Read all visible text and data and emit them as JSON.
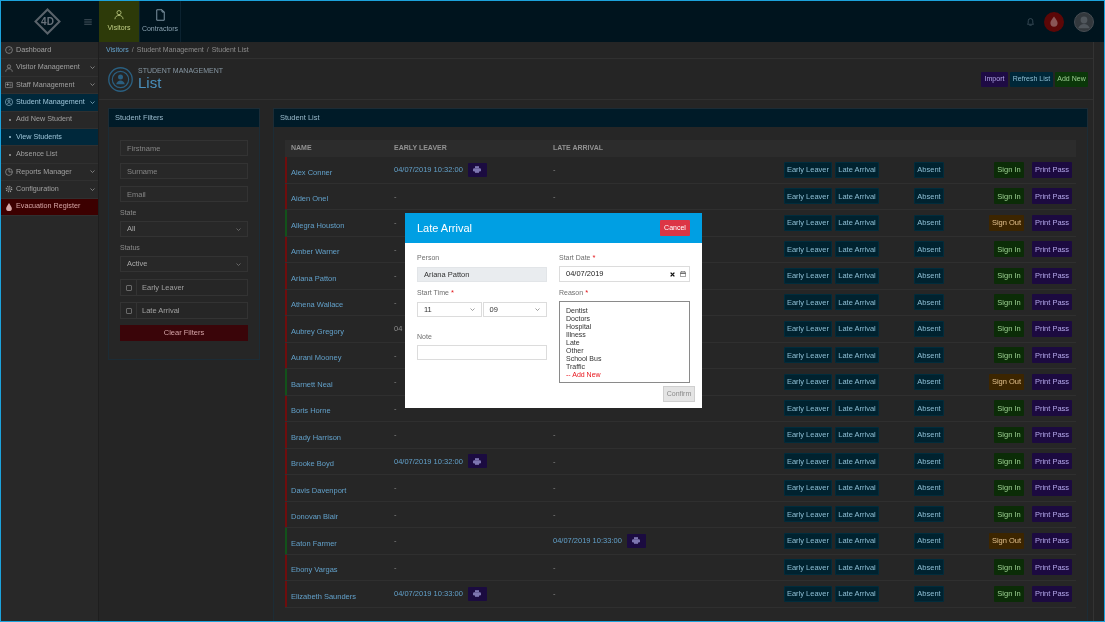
{
  "header": {
    "logo": "4D",
    "tabs": [
      {
        "label": "Visitors",
        "selected": true
      },
      {
        "label": "Contractors",
        "selected": false
      }
    ]
  },
  "sidebar": {
    "items": [
      {
        "label": "Dashboard",
        "kind": "link",
        "selected": false
      },
      {
        "label": "Visitor Management",
        "kind": "group",
        "selected": false
      },
      {
        "label": "Staff Management",
        "kind": "group",
        "selected": false
      },
      {
        "label": "Student Management",
        "kind": "group",
        "selected": true,
        "children": [
          {
            "label": "Add New Student",
            "selected": false
          },
          {
            "label": "View Students",
            "selected": true
          },
          {
            "label": "Absence List",
            "selected": false
          }
        ]
      },
      {
        "label": "Reports Manager",
        "kind": "group",
        "selected": false
      },
      {
        "label": "Configuration",
        "kind": "group",
        "selected": false
      },
      {
        "label": "Evacuation Register",
        "kind": "alert",
        "selected": false
      }
    ]
  },
  "breadcrumb": {
    "separator": "/",
    "items": [
      "Visitors",
      "Student Management",
      "Student List"
    ]
  },
  "page_header": {
    "subtitle": "STUDENT MANAGEMENT",
    "title": "List",
    "actions": [
      {
        "label": "Import",
        "kind": "import"
      },
      {
        "label": "Refresh List",
        "kind": "refresh"
      },
      {
        "label": "Add New",
        "kind": "add"
      }
    ]
  },
  "filters": {
    "title": "Student Filters",
    "fields": [
      {
        "kind": "text",
        "placeholder": "Firstname"
      },
      {
        "kind": "text",
        "placeholder": "Surname"
      },
      {
        "kind": "text",
        "placeholder": "Email"
      },
      {
        "kind": "select",
        "label": "State",
        "value": "All"
      },
      {
        "kind": "select",
        "label": "Status",
        "value": "Active"
      },
      {
        "kind": "checkbox",
        "label": "Early Leaver",
        "checked": false
      },
      {
        "kind": "checkbox",
        "label": "Late Arrival",
        "checked": false
      }
    ],
    "clear": "Clear Filters"
  },
  "student_list": {
    "title": "Student List",
    "columns": [
      "NAME",
      "EARLY LEAVER",
      "LATE ARRIVAL"
    ],
    "rows": [
      {
        "name": "Alex Conner",
        "signed_in": false,
        "early_leaver": {
          "text": "04/07/2019 10:32:00",
          "pass": true
        },
        "late_arrival": {
          "text": "-",
          "pass": false
        },
        "actions": [
          "Early Leaver",
          "Late Arrival",
          "Absent",
          "Sign In",
          "Print Pass"
        ]
      },
      {
        "name": "Aiden Onel",
        "signed_in": false,
        "early_leaver": {
          "text": "-",
          "pass": false
        },
        "late_arrival": {
          "text": "-",
          "pass": false
        },
        "actions": [
          "Early Leaver",
          "Late Arrival",
          "Absent",
          "Sign In",
          "Print Pass"
        ]
      },
      {
        "name": "Allegra Houston",
        "signed_in": true,
        "early_leaver": {
          "text": "-",
          "pass": false
        },
        "actions": [
          "Early Leaver",
          "Late Arrival",
          "Absent",
          "Sign Out",
          "Print Pass"
        ]
      },
      {
        "name": "Amber Warner",
        "signed_in": false,
        "early_leaver": {
          "text": "-",
          "pass": false
        },
        "actions": [
          "Early Leaver",
          "Late Arrival",
          "Absent",
          "Sign In",
          "Print Pass"
        ]
      },
      {
        "name": "Ariana Patton",
        "signed_in": false,
        "early_leaver": {
          "text": "-",
          "pass": false
        },
        "actions": [
          "Early Leaver",
          "Late Arrival",
          "Absent",
          "Sign In",
          "Print Pass"
        ]
      },
      {
        "name": "Athena Wallace",
        "signed_in": false,
        "early_leaver": {
          "text": "-",
          "pass": false
        },
        "actions": [
          "Early Leaver",
          "Late Arrival",
          "Absent",
          "Sign In",
          "Print Pass"
        ]
      },
      {
        "name": "Aubrey Gregory",
        "signed_in": false,
        "early_leaver": {
          "text": "04",
          "pass": false
        },
        "actions": [
          "Early Leaver",
          "Late Arrival",
          "Absent",
          "Sign In",
          "Print Pass"
        ]
      },
      {
        "name": "Aurani Mooney",
        "signed_in": false,
        "early_leaver": {
          "text": "-",
          "pass": false
        },
        "actions": [
          "Early Leaver",
          "Late Arrival",
          "Absent",
          "Sign In",
          "Print Pass"
        ]
      },
      {
        "name": "Barnett Neal",
        "signed_in": true,
        "early_leaver": {
          "text": "-",
          "pass": false
        },
        "actions": [
          "Early Leaver",
          "Late Arrival",
          "Absent",
          "Sign Out",
          "Print Pass"
        ]
      },
      {
        "name": "Boris Horne",
        "signed_in": false,
        "early_leaver": {
          "text": "-",
          "pass": false
        },
        "actions": [
          "Early Leaver",
          "Late Arrival",
          "Absent",
          "Sign In",
          "Print Pass"
        ]
      },
      {
        "name": "Brady Harrison",
        "signed_in": false,
        "early_leaver": {
          "text": "-",
          "pass": false
        },
        "late_arrival": {
          "text": "-",
          "pass": false
        },
        "actions": [
          "Early Leaver",
          "Late Arrival",
          "Absent",
          "Sign In",
          "Print Pass"
        ]
      },
      {
        "name": "Brooke Boyd",
        "signed_in": false,
        "early_leaver": {
          "text": "04/07/2019 10:32:00",
          "pass": true
        },
        "late_arrival": {
          "text": "-",
          "pass": false
        },
        "actions": [
          "Early Leaver",
          "Late Arrival",
          "Absent",
          "Sign In",
          "Print Pass"
        ]
      },
      {
        "name": "Davis Davenport",
        "signed_in": false,
        "early_leaver": {
          "text": "-",
          "pass": false
        },
        "late_arrival": {
          "text": "-",
          "pass": false
        },
        "actions": [
          "Early Leaver",
          "Late Arrival",
          "Absent",
          "Sign In",
          "Print Pass"
        ]
      },
      {
        "name": "Donovan Blair",
        "signed_in": false,
        "early_leaver": {
          "text": "-",
          "pass": false
        },
        "late_arrival": {
          "text": "-",
          "pass": false
        },
        "actions": [
          "Early Leaver",
          "Late Arrival",
          "Absent",
          "Sign In",
          "Print Pass"
        ]
      },
      {
        "name": "Eaton Farmer",
        "signed_in": true,
        "early_leaver": {
          "text": "-",
          "pass": false
        },
        "late_arrival": {
          "text": "04/07/2019 10:33:00",
          "pass": true
        },
        "actions": [
          "Early Leaver",
          "Late Arrival",
          "Absent",
          "Sign Out",
          "Print Pass"
        ]
      },
      {
        "name": "Ebony Vargas",
        "signed_in": false,
        "early_leaver": {
          "text": "-",
          "pass": false
        },
        "late_arrival": {
          "text": "-",
          "pass": false
        },
        "actions": [
          "Early Leaver",
          "Late Arrival",
          "Absent",
          "Sign In",
          "Print Pass"
        ]
      },
      {
        "name": "Elizabeth Saunders",
        "signed_in": false,
        "early_leaver": {
          "text": "04/07/2019 10:33:00",
          "pass": true
        },
        "late_arrival": {
          "text": "-",
          "pass": false
        },
        "actions": [
          "Early Leaver",
          "Late Arrival",
          "Absent",
          "Sign In",
          "Print Pass"
        ]
      }
    ]
  },
  "modal": {
    "title": "Late Arrival",
    "cancel": "Cancel",
    "person": {
      "label": "Person",
      "value": "Ariana Patton"
    },
    "start_time": {
      "label": "Start Time",
      "marker": "*",
      "hour": "11",
      "minute": "09"
    },
    "note": {
      "label": "Note"
    },
    "start_date": {
      "label": "Start Date",
      "marker": "*",
      "value": "04/07/2019"
    },
    "reason": {
      "label": "Reason",
      "marker": "*",
      "options": [
        {
          "label": "Dentist",
          "kind": "option"
        },
        {
          "label": "Doctors",
          "kind": "option"
        },
        {
          "label": "Hospital",
          "kind": "option"
        },
        {
          "label": "Illness",
          "kind": "option"
        },
        {
          "label": "Late",
          "kind": "option"
        },
        {
          "label": "Other",
          "kind": "option"
        },
        {
          "label": "School Bus",
          "kind": "option"
        },
        {
          "label": "Traffic",
          "kind": "option"
        },
        {
          "label": "-- Add New",
          "kind": "add"
        }
      ]
    },
    "confirm": {
      "label": "Confirm",
      "disabled": true
    }
  }
}
